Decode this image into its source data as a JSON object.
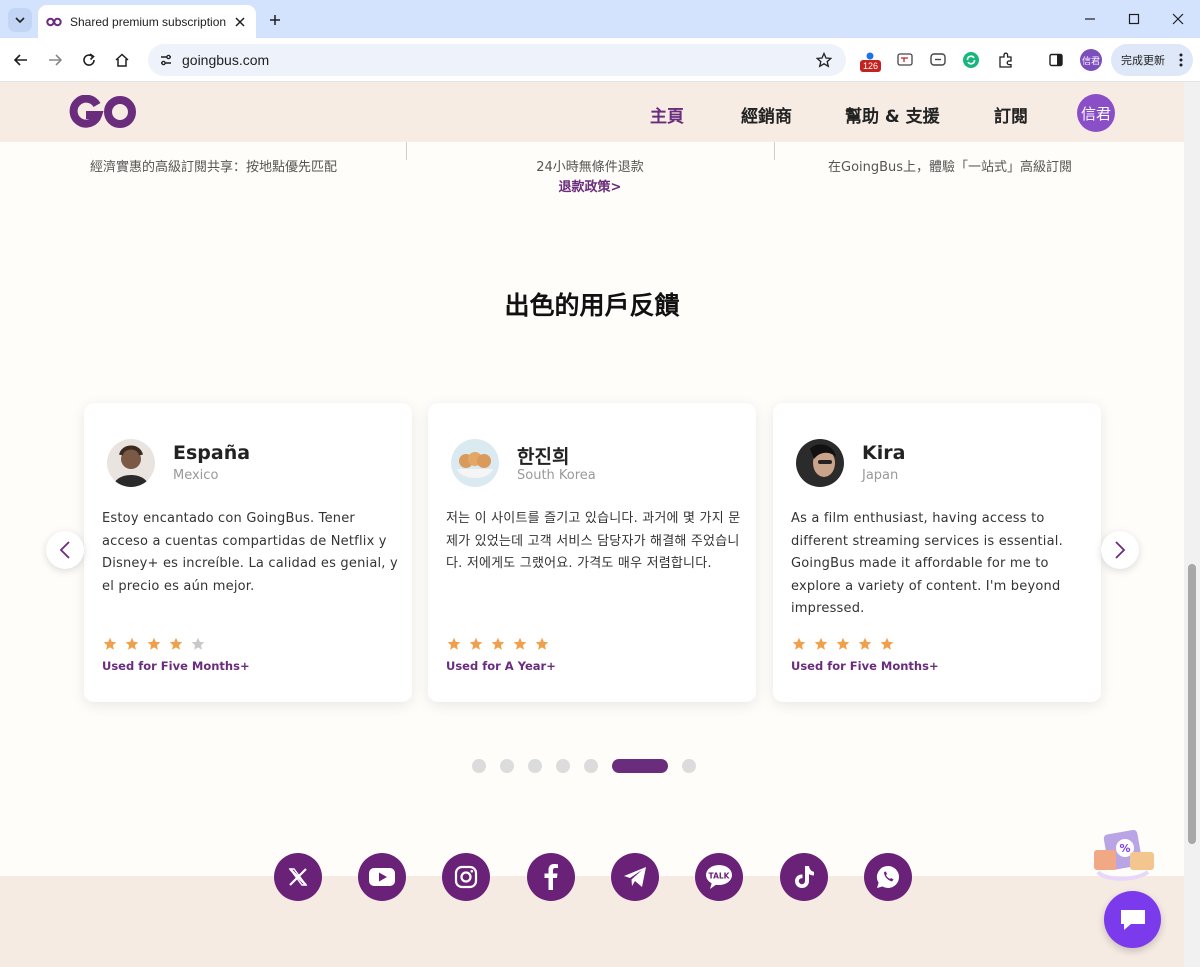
{
  "browser": {
    "tab_title": "Shared premium subscription",
    "url": "goingbus.com",
    "extension_badge": "126",
    "profile_chip": "信君",
    "update_label": "完成更新"
  },
  "site": {
    "logo_text": "GO",
    "nav": [
      "主頁",
      "經銷商",
      "幫助 & 支援",
      "訂閱"
    ],
    "avatar_text": "信君"
  },
  "features": {
    "items": [
      "經濟實惠的高級訂閱共享：按地點優先匹配",
      "24小時無條件退款",
      "在GoingBus上，體驗「一站式」高級訂閱"
    ],
    "refund_link": "退款政策>"
  },
  "section_title": "出色的用戶反饋",
  "reviews": [
    {
      "name": "España",
      "country": "Mexico",
      "text": "Estoy encantado con GoingBus. Tener acceso a cuentas compartidas de Netflix y Disney+ es increíble. La calidad es genial, y el precio es aún mejor.",
      "rating": 4,
      "usage": "Used for Five Months+"
    },
    {
      "name": "한진희",
      "country": "South Korea",
      "text": "저는 이 사이트를 즐기고 있습니다. 과거에 몇 가지 문제가 있었는데 고객 서비스 담당자가 해결해 주었습니다. 저에게도 그랬어요. 가격도 매우 저렴합니다.",
      "rating": 5,
      "usage": "Used for A Year+"
    },
    {
      "name": "Kira",
      "country": "Japan",
      "text": "As a film enthusiast, having access to different streaming services is essential. GoingBus made it affordable for me to explore a variety of content. I'm beyond impressed.",
      "rating": 5,
      "usage": "Used for Five Months+"
    }
  ],
  "carousel": {
    "total": 7,
    "active_index": 5
  },
  "social": [
    "x-icon",
    "youtube-icon",
    "instagram-icon",
    "facebook-icon",
    "telegram-icon",
    "kakaotalk-icon",
    "tiktok-icon",
    "whatsapp-icon"
  ],
  "kakao_label": "TALK",
  "colors": {
    "brand": "#6a2c7c",
    "header_bg": "#f6ece4",
    "star": "#f0a04b",
    "star_empty": "#c8c8c8",
    "chat": "#7c3aed"
  }
}
